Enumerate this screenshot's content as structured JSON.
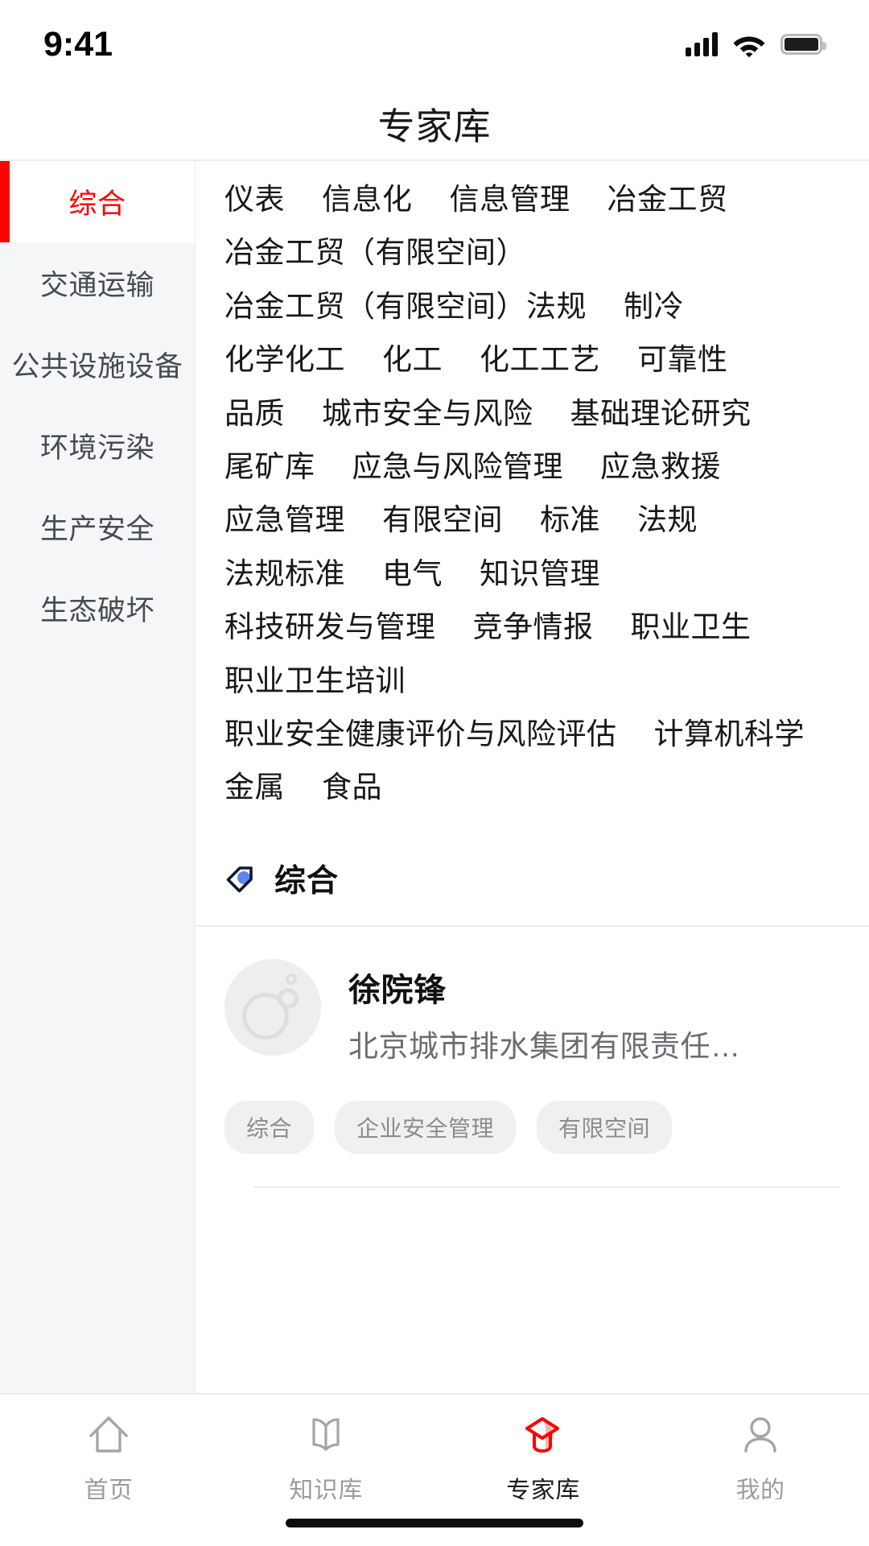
{
  "status_bar": {
    "time": "9:41",
    "signal_icon": "cellular-signal-icon",
    "wifi_icon": "wifi-icon",
    "battery_icon": "battery-full-icon"
  },
  "header": {
    "title": "专家库"
  },
  "sidebar": {
    "items": [
      {
        "label": "综合",
        "active": true
      },
      {
        "label": "交通运输",
        "active": false
      },
      {
        "label": "公共设施设备",
        "active": false
      },
      {
        "label": "环境污染",
        "active": false
      },
      {
        "label": "生产安全",
        "active": false
      },
      {
        "label": "生态破坏",
        "active": false
      }
    ]
  },
  "tag_cloud": {
    "rows": [
      [
        "仪表",
        "信息化",
        "信息管理",
        "冶金工贸"
      ],
      [
        "冶金工贸（有限空间）"
      ],
      [
        "冶金工贸（有限空间）法规",
        "制冷"
      ],
      [
        "化学化工",
        "化工",
        "化工工艺",
        "可靠性"
      ],
      [
        "品质",
        "城市安全与风险",
        "基础理论研究"
      ],
      [
        "尾矿库",
        "应急与风险管理",
        "应急救援"
      ],
      [
        "应急管理",
        "有限空间",
        "标准",
        "法规"
      ],
      [
        "法规标准",
        "电气",
        "知识管理"
      ],
      [
        "科技研发与管理",
        "竞争情报",
        "职业卫生"
      ],
      [
        "职业卫生培训"
      ],
      [
        "职业安全健康评价与风险评估",
        "计算机科学"
      ],
      [
        "金属",
        "食品"
      ]
    ]
  },
  "section": {
    "icon": "tag-icon",
    "title": "综合"
  },
  "expert": {
    "avatar_icon": "avatar-placeholder-icon",
    "name": "徐院锋",
    "organization": "北京城市排水集团有限责任…",
    "chips": [
      "综合",
      "企业安全管理",
      "有限空间"
    ]
  },
  "tabbar": {
    "items": [
      {
        "label": "首页",
        "icon": "home-icon",
        "active": false
      },
      {
        "label": "知识库",
        "icon": "book-icon",
        "active": false
      },
      {
        "label": "专家库",
        "icon": "graduation-cap-icon",
        "active": true
      },
      {
        "label": "我的",
        "icon": "person-icon",
        "active": false
      }
    ]
  },
  "colors": {
    "accent_red": "#ff0000",
    "tag_icon_blue": "#4a7af0",
    "sidebar_bg": "#f4f6f8"
  }
}
